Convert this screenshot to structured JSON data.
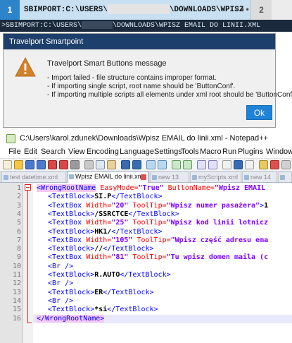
{
  "terminal": {
    "tab1_number": "1",
    "tab_path_start": "SBIMPORT:C:\\USERS\\",
    "tab_path_end": "\\DOWNLOADS\\WPISZ",
    "tab_dots": "•••",
    "tab2_number": "2",
    "command_start": ">SBIMPORT:C:\\USERS\\",
    "command_end": "\\DOWNLOADS\\WPISZ EMAIL DO LINII.XML"
  },
  "dialog": {
    "title": "Travelport Smartpoint",
    "heading": "Travelport Smart Buttons message",
    "lines": [
      "- Import failed - file structure contains improper format.",
      "- If importing single script, root name should be 'ButtonConf'.",
      "- If importing multiple scripts all elements under xml root should be 'ButtonConf'."
    ],
    "ok_label": "Ok",
    "icon": "warning-icon",
    "accent": "#1f83d8"
  },
  "notepad": {
    "title": "C:\\Users\\karol.zdunek\\Downloads\\Wpisz EMAIL do linii.xml - Notepad++",
    "menu": [
      "File",
      "Edit",
      "Search",
      "View",
      "Encoding",
      "Language",
      "Settings",
      "Tools",
      "Macro",
      "Run",
      "Plugins",
      "Window"
    ],
    "tabs": [
      "test datetime.xml",
      "Wpisz EMAIL do linii.xml",
      "new 13",
      "myScripts.xml",
      "new 14",
      ""
    ],
    "active_tab": 1
  },
  "code": [
    {
      "n": "1",
      "parts": [
        [
          "tag",
          "<WrongRootName"
        ],
        [
          "attr",
          " EasyMode="
        ],
        [
          "val",
          "\"True\""
        ],
        [
          "attr",
          " ButtonName="
        ],
        [
          "val",
          "\"Wpisz EMAIL"
        ]
      ]
    },
    {
      "n": "2",
      "parts": [
        [
          "tag",
          "<TextBlock>"
        ],
        [
          "txt",
          "SI.P"
        ],
        [
          "tag",
          "</TextBlock>"
        ]
      ]
    },
    {
      "n": "3",
      "parts": [
        [
          "tag",
          "<TextBox"
        ],
        [
          "attr",
          " Width="
        ],
        [
          "val",
          "\"20\""
        ],
        [
          "attr",
          " ToolTip="
        ],
        [
          "val",
          "\"Wpisz numer pasażera\""
        ],
        [
          "tag",
          ">"
        ],
        [
          "txt",
          "1"
        ]
      ]
    },
    {
      "n": "4",
      "parts": [
        [
          "tag",
          "<TextBlock>"
        ],
        [
          "txt",
          "/SSRCTCE"
        ],
        [
          "tag",
          "</TextBlock>"
        ]
      ]
    },
    {
      "n": "5",
      "parts": [
        [
          "tag",
          "<TextBox"
        ],
        [
          "attr",
          " Width="
        ],
        [
          "val",
          "\"25\""
        ],
        [
          "attr",
          " ToolTip="
        ],
        [
          "val",
          "\"Wpisz kod linii lotnicz"
        ]
      ]
    },
    {
      "n": "6",
      "parts": [
        [
          "tag",
          "<TextBlock>"
        ],
        [
          "txt",
          "HK1/"
        ],
        [
          "tag",
          "</TextBlock>"
        ]
      ]
    },
    {
      "n": "7",
      "parts": [
        [
          "tag",
          "<TextBox"
        ],
        [
          "attr",
          " Width="
        ],
        [
          "val",
          "\"105\""
        ],
        [
          "attr",
          " ToolTip="
        ],
        [
          "val",
          "\"Wpisz część adresu ema"
        ]
      ]
    },
    {
      "n": "8",
      "parts": [
        [
          "tag",
          "<TextBlock>"
        ],
        [
          "txt",
          "//"
        ],
        [
          "tag",
          "</TextBlock>"
        ]
      ]
    },
    {
      "n": "9",
      "parts": [
        [
          "tag",
          "<TextBox"
        ],
        [
          "attr",
          " Width="
        ],
        [
          "val",
          "\"81\""
        ],
        [
          "attr",
          " ToolTip="
        ],
        [
          "val",
          "\"Tu wpisz domen maila (c"
        ]
      ]
    },
    {
      "n": "10",
      "parts": [
        [
          "tag",
          "<Br />"
        ]
      ]
    },
    {
      "n": "11",
      "parts": [
        [
          "tag",
          "<TextBlock>"
        ],
        [
          "txt",
          "R.AUTO"
        ],
        [
          "tag",
          "</TextBlock>"
        ]
      ]
    },
    {
      "n": "12",
      "parts": [
        [
          "tag",
          "<Br />"
        ]
      ]
    },
    {
      "n": "13",
      "parts": [
        [
          "tag",
          "<TextBlock>"
        ],
        [
          "txt",
          "ER"
        ],
        [
          "tag",
          "</TextBlock>"
        ]
      ]
    },
    {
      "n": "14",
      "parts": [
        [
          "tag",
          "<Br />"
        ]
      ]
    },
    {
      "n": "15",
      "parts": [
        [
          "tag",
          "<TextBlock>"
        ],
        [
          "txt",
          "*si"
        ],
        [
          "tag",
          "</TextBlock>"
        ]
      ]
    },
    {
      "n": "16",
      "parts": [
        [
          "tag",
          "</WrongRootName>"
        ]
      ]
    }
  ]
}
